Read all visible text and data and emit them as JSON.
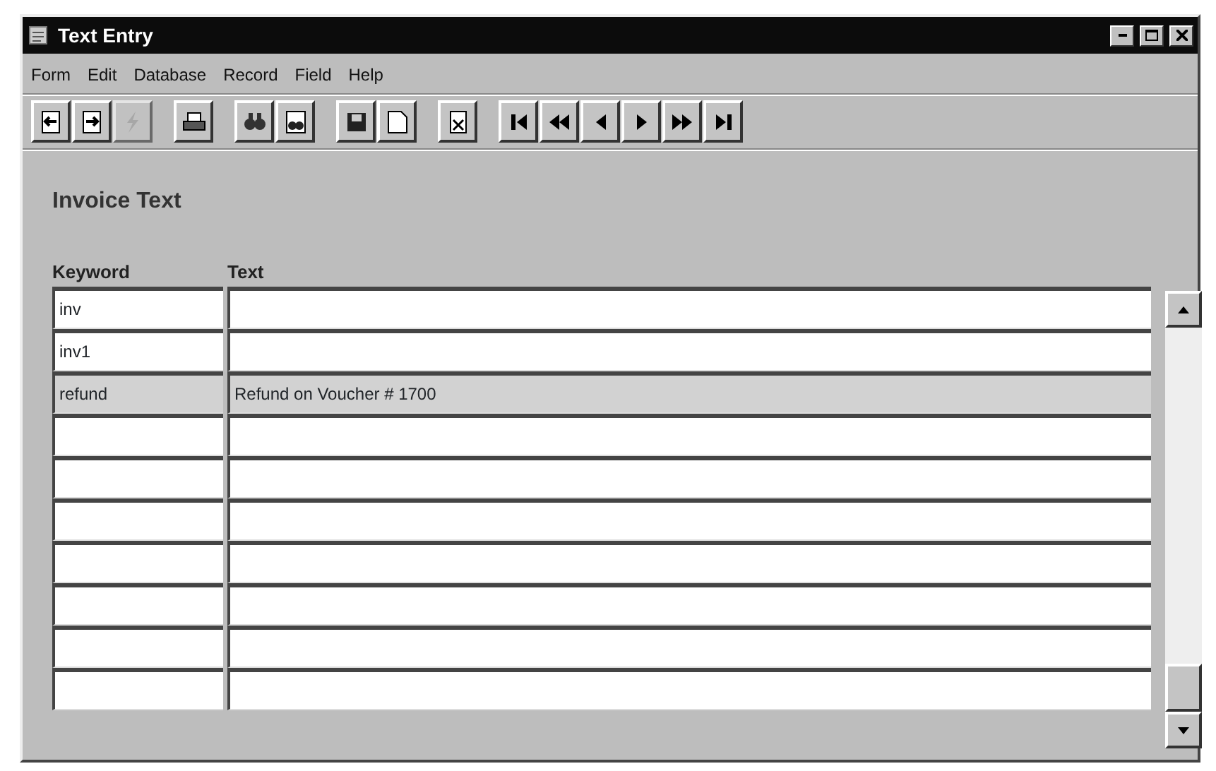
{
  "window": {
    "title": "Text Entry"
  },
  "menu": [
    "Form",
    "Edit",
    "Database",
    "Record",
    "Field",
    "Help"
  ],
  "toolbar_groups": [
    {
      "buttons": [
        {
          "kind": "doc-left",
          "disabled": false
        },
        {
          "kind": "doc-right",
          "disabled": false
        },
        {
          "kind": "lightning",
          "disabled": true
        }
      ]
    },
    {
      "buttons": [
        {
          "kind": "printer",
          "disabled": false
        }
      ]
    },
    {
      "buttons": [
        {
          "kind": "binoculars",
          "disabled": false
        },
        {
          "kind": "doc-binoculars",
          "disabled": false
        }
      ]
    },
    {
      "buttons": [
        {
          "kind": "disk",
          "disabled": false
        },
        {
          "kind": "page",
          "disabled": false
        }
      ]
    },
    {
      "buttons": [
        {
          "kind": "doc-x",
          "disabled": false
        }
      ]
    },
    {
      "buttons": [
        {
          "kind": "first",
          "disabled": false
        },
        {
          "kind": "rewind",
          "disabled": false
        },
        {
          "kind": "prev",
          "disabled": false
        },
        {
          "kind": "next",
          "disabled": false
        },
        {
          "kind": "forward",
          "disabled": false
        },
        {
          "kind": "last",
          "disabled": false
        }
      ]
    }
  ],
  "form": {
    "title": "Invoice Text",
    "columns": [
      "Keyword",
      "Text"
    ],
    "rows": [
      {
        "keyword": "inv",
        "selected": false
      },
      {
        "keyword": "inv1",
        "selected": false
      },
      {
        "keyword": "refund",
        "text": "Refund on Voucher # 1700",
        "selected": true
      },
      {
        "selected": false
      },
      {
        "selected": false
      },
      {
        "selected": false
      },
      {
        "selected": false
      },
      {
        "selected": false
      },
      {
        "selected": false
      },
      {
        "selected": false
      }
    ]
  }
}
